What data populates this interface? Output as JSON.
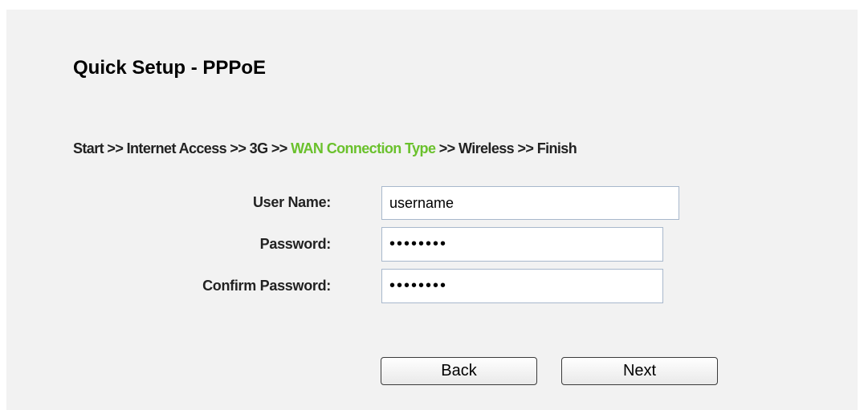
{
  "page": {
    "title": "Quick Setup - PPPoE"
  },
  "breadcrumb": {
    "before_active": "Start >> Internet Access >> 3G >> ",
    "active": "WAN Connection Type",
    "after_active": " >> Wireless >> Finish",
    "active_color": "#6ac12c"
  },
  "form": {
    "user_name_label": "User Name:",
    "user_name_value": "username",
    "password_label": "Password:",
    "password_value": "••••••••",
    "confirm_password_label": "Confirm Password:",
    "confirm_password_value": "••••••••"
  },
  "buttons": {
    "back_label": "Back",
    "next_label": "Next"
  }
}
